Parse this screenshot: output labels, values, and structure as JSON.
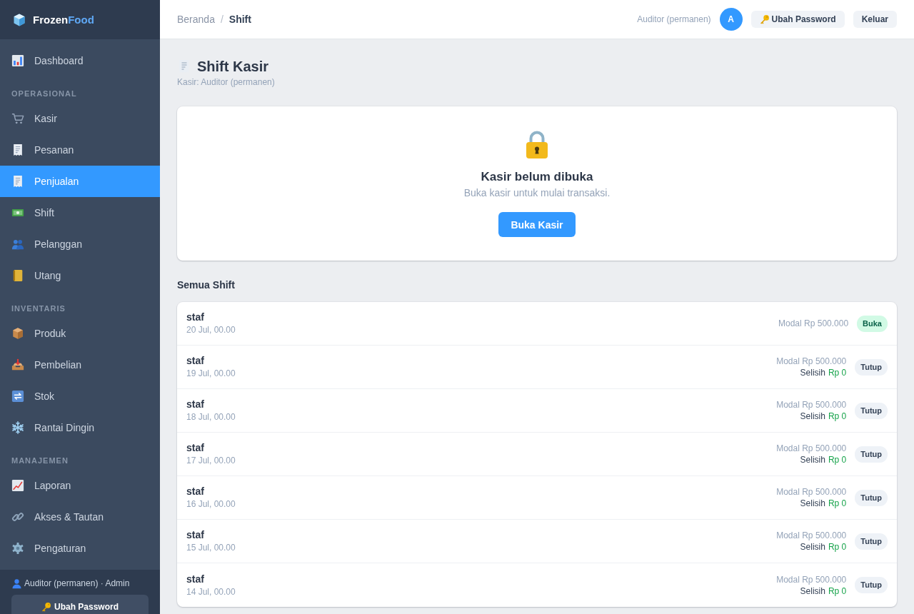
{
  "sidebar": {
    "brand": {
      "name": "Frozen",
      "accent": "Food"
    },
    "sections": [
      {
        "items": [
          {
            "label": "Dashboard",
            "selected": false
          }
        ]
      },
      {
        "heading": "OPERASIONAL",
        "items": [
          {
            "label": "Kasir",
            "selected": false
          },
          {
            "label": "Pesanan",
            "selected": false
          },
          {
            "label": "Penjualan",
            "selected": true
          },
          {
            "label": "Shift",
            "selected": false
          },
          {
            "label": "Pelanggan",
            "selected": false
          },
          {
            "label": "Utang",
            "selected": false
          }
        ]
      },
      {
        "heading": "INVENTARIS",
        "items": [
          {
            "label": "Produk",
            "selected": false
          },
          {
            "label": "Pembelian",
            "selected": false
          },
          {
            "label": "Stok",
            "selected": false
          },
          {
            "label": "Rantai Dingin",
            "selected": false
          }
        ]
      },
      {
        "heading": "MANAJEMEN",
        "items": [
          {
            "label": "Laporan",
            "selected": false
          },
          {
            "label": "Akses & Tautan",
            "selected": false
          },
          {
            "label": "Pengaturan",
            "selected": false
          }
        ]
      }
    ],
    "footer": {
      "user": "Auditor (permanen) · Admin",
      "button": "Ubah Password"
    }
  },
  "header": {
    "breadcrumb": [
      {
        "label": "Beranda",
        "current": false
      },
      {
        "label": "Shift",
        "current": true
      }
    ],
    "separator": "/",
    "user_name": "Auditor (permanen)",
    "avatar": "A",
    "buttons": [
      {
        "label": "Ubah Password",
        "kind": "password"
      },
      {
        "label": "Keluar",
        "kind": "logout"
      }
    ]
  },
  "page": {
    "title": "Shift Kasir",
    "subtitle": "Kasir: Auditor (permanen)"
  },
  "register": {
    "title": "Kasir belum dibuka",
    "message": "Buka kasir untuk mulai transaksi.",
    "button": "Buka Kasir"
  },
  "shifts": {
    "heading": "Semua Shift",
    "rows": [
      {
        "name": "staf",
        "time": "20 Jul, 00.00",
        "opening": "Modal Rp 500.000",
        "status": {
          "label": "Buka",
          "kind": "open"
        }
      },
      {
        "name": "staf",
        "time": "19 Jul, 00.00",
        "opening": "Modal Rp 500.000",
        "difference": {
          "label": "Selisih",
          "value": "Rp 0"
        },
        "status": {
          "label": "Tutup",
          "kind": "closed"
        }
      },
      {
        "name": "staf",
        "time": "18 Jul, 00.00",
        "opening": "Modal Rp 500.000",
        "difference": {
          "label": "Selisih",
          "value": "Rp 0"
        },
        "status": {
          "label": "Tutup",
          "kind": "closed"
        }
      },
      {
        "name": "staf",
        "time": "17 Jul, 00.00",
        "opening": "Modal Rp 500.000",
        "difference": {
          "label": "Selisih",
          "value": "Rp 0"
        },
        "status": {
          "label": "Tutup",
          "kind": "closed"
        }
      },
      {
        "name": "staf",
        "time": "16 Jul, 00.00",
        "opening": "Modal Rp 500.000",
        "difference": {
          "label": "Selisih",
          "value": "Rp 0"
        },
        "status": {
          "label": "Tutup",
          "kind": "closed"
        }
      },
      {
        "name": "staf",
        "time": "15 Jul, 00.00",
        "opening": "Modal Rp 500.000",
        "difference": {
          "label": "Selisih",
          "value": "Rp 0"
        },
        "status": {
          "label": "Tutup",
          "kind": "closed"
        }
      },
      {
        "name": "staf",
        "time": "14 Jul, 00.00",
        "opening": "Modal Rp 500.000",
        "difference": {
          "label": "Selisih",
          "value": "Rp 0"
        },
        "status": {
          "label": "Tutup",
          "kind": "closed"
        }
      }
    ]
  }
}
